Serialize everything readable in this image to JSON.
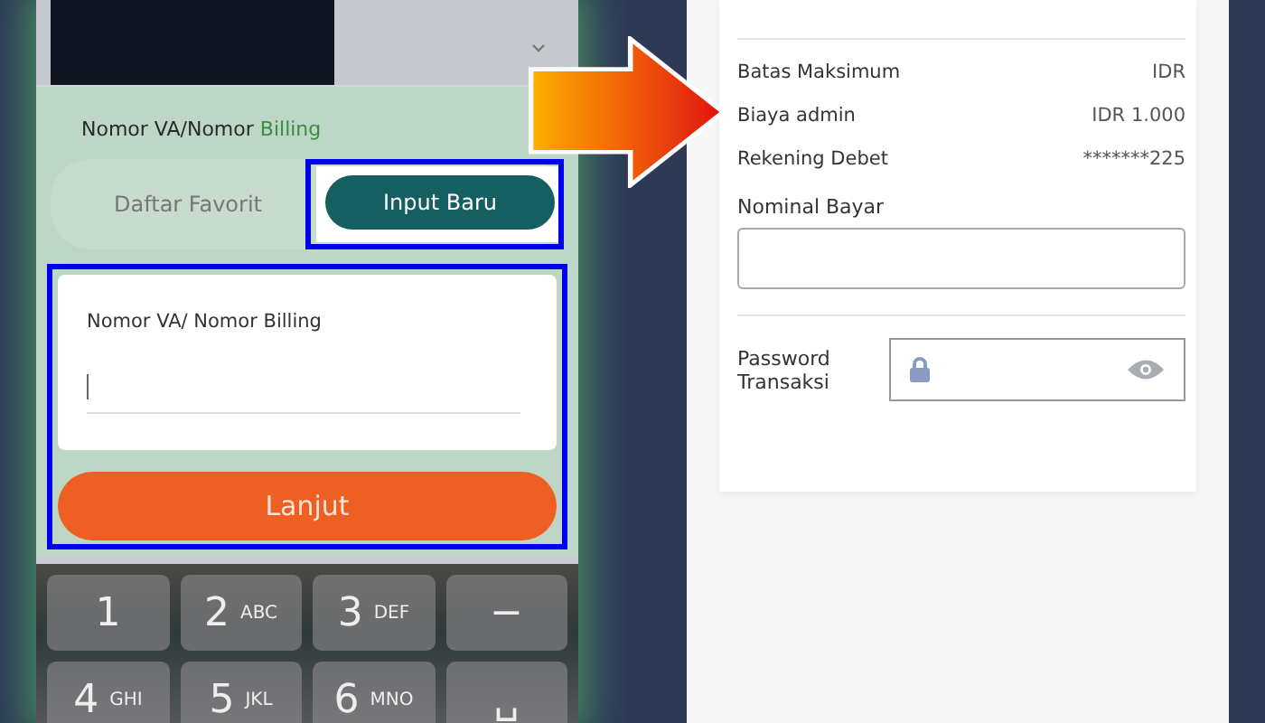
{
  "left_screen": {
    "billing_section": {
      "title_parts": [
        {
          "text": "Nomor VA/Nomor",
          "accent": false
        },
        {
          "text": "Billing",
          "accent": true
        }
      ],
      "tabs": [
        {
          "label": "Daftar Favorit",
          "selected": false,
          "highlighted": false
        },
        {
          "label": "Input Baru",
          "selected": true,
          "highlighted": true
        }
      ]
    },
    "input_card": {
      "label": "Nomor VA/ Nomor Billing",
      "highlighted": true
    },
    "submit_button": "Lanjut",
    "keypad": [
      {
        "digit": "1"
      },
      {
        "digit": "2",
        "letters": "ABC"
      },
      {
        "digit": "3",
        "letters": "DEF"
      },
      {
        "digit": "−"
      },
      {
        "digit": "4",
        "letters": "GHI"
      },
      {
        "digit": "5",
        "letters": "JKL"
      },
      {
        "digit": "6",
        "letters": "MNO"
      },
      {
        "digit": "␣"
      }
    ]
  },
  "right_screen": {
    "details": [
      {
        "label": "Batas Maksimum",
        "value": "IDR"
      },
      {
        "label": "Biaya admin",
        "value": "IDR 1.000"
      },
      {
        "label": "Rekening Debet",
        "value": "*******225"
      }
    ],
    "amount_field": {
      "label": "Nominal Bayar"
    },
    "password_field": {
      "label": "Password Transaksi"
    }
  }
}
